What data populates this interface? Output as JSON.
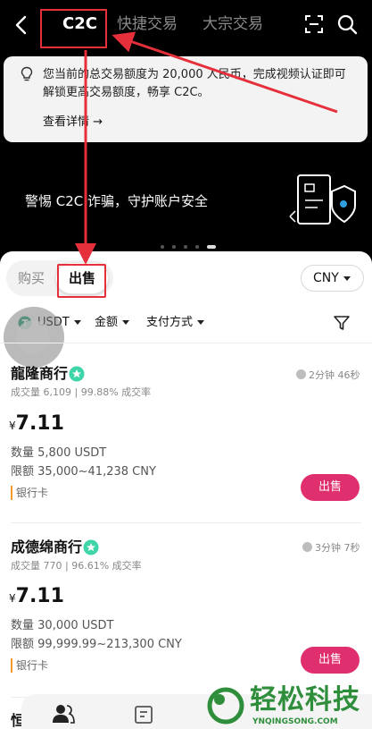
{
  "nav": {
    "tabs": [
      {
        "label": "C2C"
      },
      {
        "label": "快捷交易"
      },
      {
        "label": "大宗交易"
      }
    ],
    "back_icon": "back-arrow-icon",
    "scan_icon": "scan-icon",
    "search_icon": "search-icon"
  },
  "notice": {
    "icon": "lightbulb-icon",
    "text": "您当前的总交易额度为 20,000 人民币，完成视频认证即可解锁更高交易额度，畅享 C2C。",
    "link": "查看详情 →"
  },
  "banner": {
    "text": "警惕 C2C 诈骗，守护账户安全",
    "illustration": "security-shield-icon"
  },
  "trade_toggle": {
    "buy": "购买",
    "sell": "出售",
    "selected": "出售"
  },
  "currency": "CNY",
  "filters": {
    "coin": "USDT",
    "amount": "金额",
    "payment": "支付方式",
    "filter_icon": "funnel-icon"
  },
  "listings": [
    {
      "merchant": "龍隆商行",
      "trades_label": "成交量",
      "trades": "6,109",
      "completion_rate": "99.88%",
      "completion_label": "成交率",
      "time": "2分钟 46秒",
      "currency_symbol": "¥",
      "price": "7.11",
      "quantity_label": "数量",
      "quantity": "5,800 USDT",
      "limit_label": "限额",
      "limit": "35,000~41,238 CNY",
      "payment": "银行卡",
      "action": "出售"
    },
    {
      "merchant": "成德绵商行",
      "trades_label": "成交量",
      "trades": "770",
      "completion_rate": "96.61%",
      "completion_label": "成交率",
      "time": "3分钟 7秒",
      "currency_symbol": "¥",
      "price": "7.11",
      "quantity_label": "数量",
      "quantity": "30,000 USDT",
      "limit_label": "限额",
      "limit": "99,999.99~213,300 CNY",
      "payment": "银行卡",
      "action": "出售"
    },
    {
      "merchant": "恒"
    }
  ],
  "bottom_bar": {
    "icons": [
      "user-group-icon",
      "document-icon"
    ]
  },
  "watermark": {
    "text": "轻松科技",
    "url": "YNQINGSONG.COM"
  },
  "colors": {
    "annotation_red": "#e5303c",
    "sell_button": "#e02f6e",
    "verified_badge": "#3ed5a8",
    "watermark_green": "#2f8e3c"
  }
}
